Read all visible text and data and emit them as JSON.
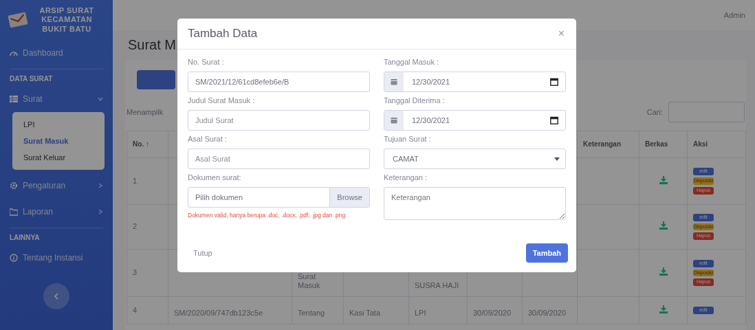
{
  "sidebar": {
    "brand": "ARSIP SURAT KECAMATAN BUKIT BATU",
    "items": [
      {
        "kind": "link",
        "label": "Dashboard",
        "selected": false
      },
      {
        "kind": "heading",
        "label": "DATA SURAT"
      },
      {
        "kind": "group",
        "label": "Surat",
        "expanded": true,
        "children": [
          {
            "label": "LPI",
            "selected": false
          },
          {
            "label": "Surat Masuk",
            "selected": true
          },
          {
            "label": "Surat Keluar",
            "selected": false
          }
        ]
      },
      {
        "kind": "group",
        "label": "Pengaturan",
        "expanded": false
      },
      {
        "kind": "group",
        "label": "Laporan",
        "expanded": false
      },
      {
        "kind": "heading",
        "label": "LAINNYA"
      },
      {
        "kind": "link",
        "label": "Tentang Instansi",
        "selected": false
      }
    ]
  },
  "topbar": {
    "user": "Admin"
  },
  "page": {
    "title": "Surat M",
    "showing": "Menampilk",
    "search_label": "Cari:"
  },
  "table": {
    "columns": [
      "No. ↑",
      "Keterangan",
      "Berkas",
      "Aksi"
    ],
    "rows": [
      {
        "no": "1",
        "actions": [
          "edit",
          "Disposisi",
          "Hapus"
        ]
      },
      {
        "no": "2",
        "actions": [
          "edit",
          "Disposisi",
          "Hapus"
        ]
      },
      {
        "no": "3",
        "judul": "Surat Masuk",
        "tujuan": "SUSRA HAJI",
        "actions": [
          "edit",
          "Disposisi",
          "Hapus"
        ]
      },
      {
        "no": "4",
        "no_surat": "SM/2020/09/747db123c5e",
        "judul": "Tentang",
        "asal": "Kasi Tata",
        "tujuan": "LPI",
        "tgl_masuk": "30/09/2020",
        "tgl_diterima": "30/09/2020",
        "actions": [
          "edit"
        ]
      }
    ]
  },
  "modal": {
    "title": "Tambah Data",
    "close": "×",
    "fields": [
      {
        "kind": "text",
        "label": "No. Surat :",
        "value": "SM/2021/12/61cd8efeb6e/B"
      },
      {
        "kind": "date",
        "label": "Tanggal Masuk :",
        "value": "12/30/2021"
      },
      {
        "kind": "text",
        "label": "Judul Surat Masuk :",
        "placeholder": "Judul Surat"
      },
      {
        "kind": "date",
        "label": "Tanggal Diterima :",
        "value": "12/30/2021"
      },
      {
        "kind": "text",
        "label": "Asal Surat :",
        "placeholder": "Asal Surat"
      },
      {
        "kind": "select",
        "label": "Tujuan Surat :",
        "value": "CAMAT"
      },
      {
        "kind": "file",
        "label": "Dokumen surat:",
        "placeholder": "Pilih dokumen",
        "button": "Browse",
        "help": "Dokumen valid, hanya berupa .doc, .docx, .pdf, .jpg dan .png"
      },
      {
        "kind": "textarea",
        "label": "Keterangan :",
        "placeholder": "Keterangan"
      }
    ],
    "buttons": [
      {
        "kind": "secondary",
        "label": "Tutup"
      },
      {
        "kind": "primary",
        "label": "Tambah"
      }
    ]
  }
}
